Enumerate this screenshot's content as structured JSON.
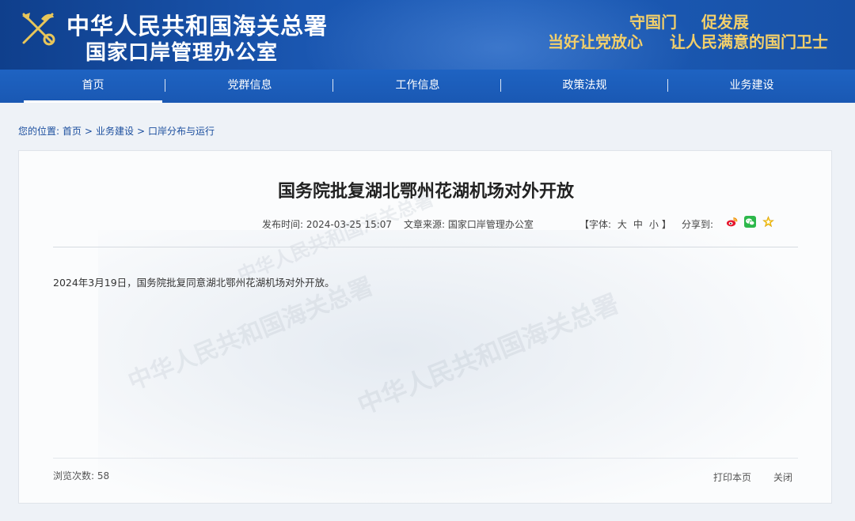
{
  "header": {
    "brand_line1": "中华人民共和国海关总署",
    "brand_line2": "国家口岸管理办公室",
    "slogans": [
      "守国门",
      "促发展",
      "当好让党放心",
      "让人民满意的国门卫士"
    ]
  },
  "nav": {
    "items": [
      {
        "label": "首页",
        "active": true
      },
      {
        "label": "党群信息",
        "active": false
      },
      {
        "label": "工作信息",
        "active": false
      },
      {
        "label": "政策法规",
        "active": false
      },
      {
        "label": "业务建设",
        "active": false
      }
    ],
    "separator": "|"
  },
  "breadcrumb": {
    "prefix": "您的位置:",
    "items": [
      "首页",
      "业务建设",
      "口岸分布与运行"
    ],
    "separator": ">"
  },
  "article": {
    "title": "国务院批复湖北鄂州花湖机场对外开放",
    "date_label": "发布时间:",
    "date": "2024-03-25 15:07",
    "source_label": "文章来源:",
    "source": "国家口岸管理办公室",
    "font_open": "【字体:",
    "font_sizes": [
      "大",
      "中",
      "小"
    ],
    "font_close": "】",
    "share_label": "分享到:",
    "body": "2024年3月19日，国务院批复同意湖北鄂州花湖机场对外开放。",
    "views_label": "浏览次数:",
    "views": "58",
    "print_label": "打印本页",
    "close_label": "关闭"
  },
  "watermark": {
    "text": "中华人民共和国海关总署"
  },
  "icons": {
    "emblem": "customs-emblem-icon",
    "weibo": "weibo-icon",
    "wechat": "wechat-icon",
    "favorite": "favorite-star-icon"
  },
  "colors": {
    "header_blue": "#1a56b0",
    "nav_blue": "#1e63c2",
    "slogan_gold": "#f2cf6a",
    "link_blue": "#1b4e9e"
  }
}
